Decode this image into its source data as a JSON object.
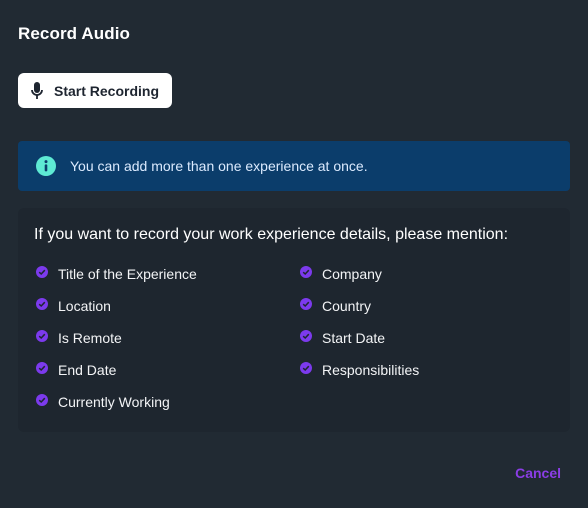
{
  "dialog": {
    "title": "Record Audio",
    "record_button": {
      "label": "Start Recording",
      "icon": "microphone-icon"
    },
    "info": {
      "icon": "info-icon",
      "text": "You can add more than one experience at once."
    },
    "card": {
      "heading": "If you want to record your work experience details, please mention:",
      "left_items": [
        "Title of the Experience",
        "Location",
        "Is Remote",
        "End Date",
        "Currently Working"
      ],
      "right_items": [
        "Company",
        "Country",
        "Start Date",
        "Responsibilities"
      ]
    },
    "cancel_label": "Cancel"
  },
  "colors": {
    "background": "#212a33",
    "banner": "#0b3d6b",
    "info_icon": "#5eead4",
    "accent": "#7c3aed",
    "check": "#7c3aed"
  }
}
